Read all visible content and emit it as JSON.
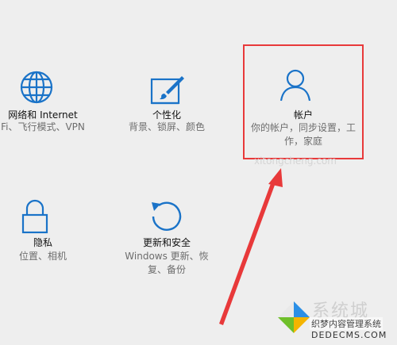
{
  "colors": {
    "background": "#eeeeee",
    "icon_accent": "#1a73c8",
    "highlight_border": "#e8393a",
    "arrow": "#e8393a",
    "label_text": "#111111",
    "desc_text": "#6d6d6d"
  },
  "settings_tiles": [
    {
      "icon": "globe-icon",
      "label": "网络和 Internet",
      "desc_lines": [
        "Fi、飞行模式、VPN"
      ]
    },
    {
      "icon": "paint-tablet-icon",
      "label": "个性化",
      "desc_lines": [
        "背景、锁屏、颜色"
      ]
    },
    {
      "icon": "person-icon",
      "label": "帐户",
      "desc_lines": [
        "你的帐户，同步设置，工",
        "作，家庭"
      ],
      "highlighted": true
    },
    {
      "icon": "lock-icon",
      "label": "隐私",
      "desc_lines": [
        "位置、相机"
      ]
    },
    {
      "icon": "refresh-icon",
      "label": "更新和安全",
      "desc_lines": [
        "Windows 更新、恢",
        "复、备份"
      ]
    }
  ],
  "background_watermark": "xitongcheng.com",
  "watermark": {
    "brand": "系统城",
    "tagline": "织梦内容管理系统",
    "domain": "DEDECMS.COM"
  }
}
